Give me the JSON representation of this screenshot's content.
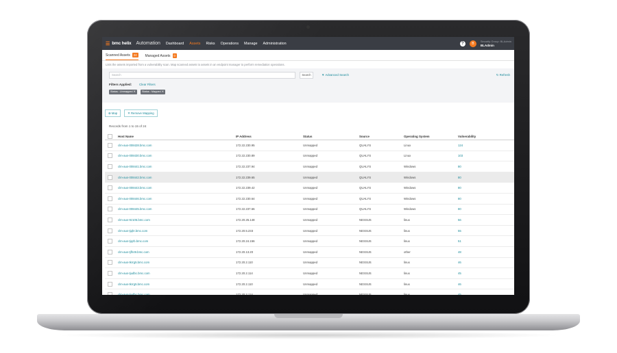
{
  "app": {
    "brand_mark": "bmc",
    "brand_name": "bmc helix",
    "product": "Automation",
    "nav": [
      "Dashboard",
      "Assets",
      "Risks",
      "Operations",
      "Manage",
      "Administration"
    ],
    "nav_active": "Assets",
    "help_glyph": "?",
    "user_initial": "B",
    "user_role": "Security Group: BLAdmin",
    "user_name": "BLAdmin"
  },
  "tabs": [
    {
      "label": "Scanned Assets",
      "count": "24"
    },
    {
      "label": "Managed Assets",
      "count": "0"
    }
  ],
  "subtitle": "Lists the assets imported from a vulnerability scan. Map scanned assets to assets in an endpoint manager to perform remediation operations.",
  "filters": {
    "search_placeholder": "Search",
    "search_button": "Search",
    "advanced_search": "Advanced Search",
    "refresh": "Refresh",
    "applied_label": "Filters Applied:",
    "clear_label": "Clear Filters",
    "chips": [
      "Status : Unmapped ✕",
      "Status : Mapped ✕"
    ]
  },
  "actions": {
    "map": "⊕ Map",
    "remove_mapping": "✕ Remove Mapping"
  },
  "records_text": "Records from 1 to 15 of 24",
  "table": {
    "columns": [
      "Host Name",
      "IP Address",
      "Status",
      "Source",
      "Operating System",
      "Vulnerability"
    ],
    "rows": [
      [
        "clm-aus-008428.bmc.com",
        "172.22.230.95",
        "Unmapped",
        "QUALYS",
        "Linux",
        "124"
      ],
      [
        "clm-aus-008430.bmc.com",
        "172.22.230.89",
        "Unmapped",
        "QUALYS",
        "Linux",
        "103"
      ],
      [
        "clm-aus-008441.bmc.com",
        "172.22.237.94",
        "Unmapped",
        "QUALYS",
        "Windows",
        "80"
      ],
      [
        "clm-aus-008442.bmc.com",
        "172.22.239.65",
        "Unmapped",
        "QUALYS",
        "Windows",
        "80"
      ],
      [
        "clm-aus-008443.bmc.com",
        "172.22.239.42",
        "Unmapped",
        "QUALYS",
        "Windows",
        "80"
      ],
      [
        "clm-aus-008446.bmc.com",
        "172.22.230.64",
        "Unmapped",
        "QUALYS",
        "Windows",
        "80"
      ],
      [
        "clm-aus-008445.bmc.com",
        "172.22.237.66",
        "Unmapped",
        "QUALYS",
        "Windows",
        "80"
      ],
      [
        "clm-aus-9z105.bmc.com",
        "172.20.25.148",
        "Unmapped",
        "NESSUS",
        "linux",
        "56"
      ],
      [
        "clm-aus-tjqhr.bmc.com",
        "172.20.5.233",
        "Unmapped",
        "NESSUS",
        "linux",
        "55"
      ],
      [
        "clm-aus-tjqzb.bmc.com",
        "172.20.24.156",
        "Unmapped",
        "NESSUS",
        "linux",
        "51"
      ],
      [
        "clm-aus-tjfh49.bmc.com",
        "172.20.13.20",
        "Unmapped",
        "NESSUS",
        "other",
        "48"
      ],
      [
        "clm-aus-tkrrg5.bmc.com",
        "172.20.2.110",
        "Unmapped",
        "NESSUS",
        "linux",
        "46"
      ],
      [
        "clm-aus-tjudbc.bmc.com",
        "172.20.2.114",
        "Unmapped",
        "NESSUS",
        "linux",
        "45"
      ],
      [
        "clm-aus-tkrrg5.bmc.com",
        "172.20.2.110",
        "Unmapped",
        "NESSUS",
        "linux",
        "46"
      ],
      [
        "clm-aus-tjudbc.bmc.com",
        "172.20.2.114",
        "Unmapped",
        "NESSUS",
        "linux",
        "45"
      ]
    ],
    "selected_row": 3
  }
}
